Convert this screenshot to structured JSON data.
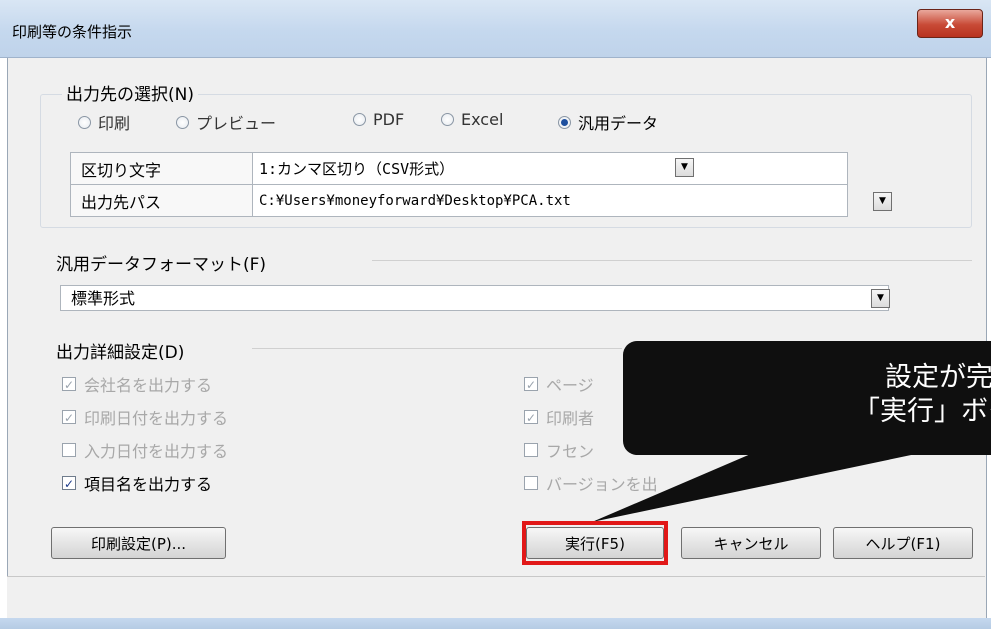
{
  "window": {
    "title": "印刷等の条件指示",
    "close_label": "x"
  },
  "output_dest": {
    "group_label": "出力先の選択(N)",
    "radios": [
      {
        "label": "印刷",
        "selected": false
      },
      {
        "label": "プレビュー",
        "selected": false
      },
      {
        "label": "PDF",
        "selected": false
      },
      {
        "label": "Excel",
        "selected": false
      },
      {
        "label": "汎用データ",
        "selected": true
      }
    ],
    "rows": [
      {
        "label": "区切り文字",
        "value": "1:カンマ区切り（CSV形式）"
      },
      {
        "label": "出力先パス",
        "value": "C:¥Users¥moneyforward¥Desktop¥PCA.txt"
      }
    ]
  },
  "format": {
    "group_label": "汎用データフォーマット(F)",
    "value": "標準形式"
  },
  "detail": {
    "group_label": "出力詳細設定(D)",
    "left": [
      {
        "label": "会社名を出力する",
        "checked": true,
        "enabled": false
      },
      {
        "label": "印刷日付を出力する",
        "checked": true,
        "enabled": false
      },
      {
        "label": "入力日付を出力する",
        "checked": false,
        "enabled": false
      },
      {
        "label": "項目名を出力する",
        "checked": true,
        "enabled": true
      }
    ],
    "right": [
      {
        "label": "ページ",
        "checked": true,
        "enabled": false
      },
      {
        "label": "印刷者",
        "checked": true,
        "enabled": false
      },
      {
        "label": "フセン",
        "checked": false,
        "enabled": false
      },
      {
        "label": "バージョンを出",
        "checked": false,
        "enabled": false
      }
    ]
  },
  "buttons": {
    "print_settings": "印刷設定(P)...",
    "execute": "実行(F5)",
    "cancel": "キャンセル",
    "help": "ヘルプ(F1)"
  },
  "callout": {
    "line1": "設定が完了したら",
    "line2": "「実行」ボタンをクリック"
  },
  "colors": {
    "highlight": "#e11818",
    "callout_bg": "#0f0f0f",
    "selected_radio": "#1d4f9e"
  }
}
